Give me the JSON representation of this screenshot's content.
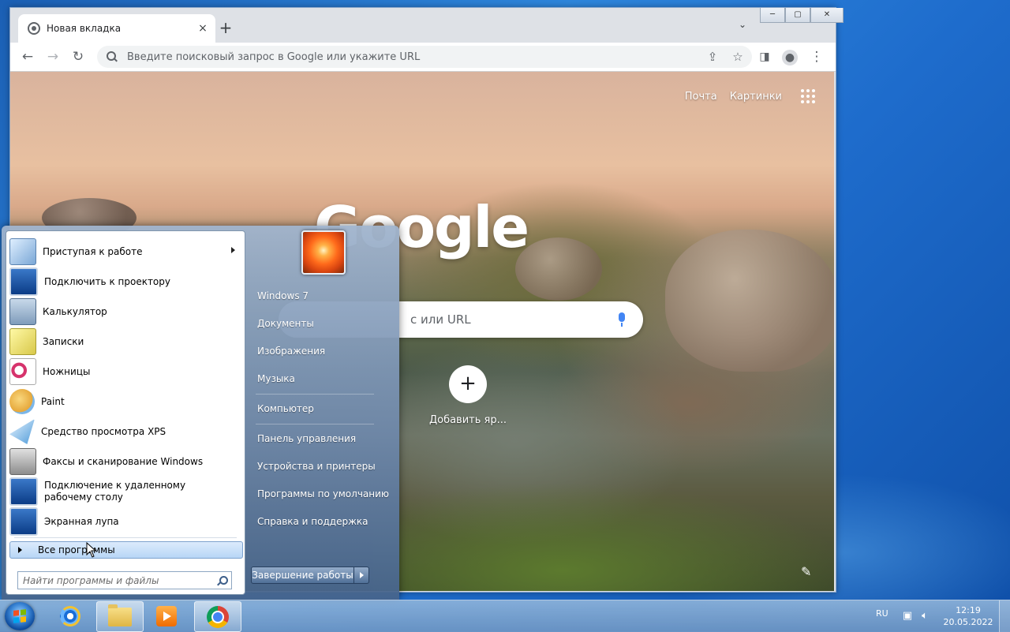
{
  "browser": {
    "tab_title": "Новая вкладка",
    "tab_close": "×",
    "new_tab": "+",
    "tab_search": "⌄",
    "omnibox_placeholder": "Введите поисковый запрос в Google или укажите URL",
    "window_controls": {
      "minimize": "─",
      "maximize": "▢",
      "close": "✕"
    }
  },
  "google_page": {
    "links": [
      "Почта",
      "Картинки"
    ],
    "logo": "Google",
    "search_text": "с или URL",
    "shortcut_add": "+",
    "shortcut_label": "Добавить яр..."
  },
  "start_menu": {
    "programs": [
      {
        "label": "Приступая к работе",
        "icon": "getting-started",
        "has_submenu": true
      },
      {
        "label": "Подключить к проектору",
        "icon": "projector"
      },
      {
        "label": "Калькулятор",
        "icon": "calculator"
      },
      {
        "label": "Записки",
        "icon": "sticky-notes"
      },
      {
        "label": "Ножницы",
        "icon": "snipping-tool"
      },
      {
        "label": "Paint",
        "icon": "paint"
      },
      {
        "label": "Средство просмотра XPS",
        "icon": "xps-viewer"
      },
      {
        "label": "Факсы и сканирование Windows",
        "icon": "fax-scan"
      },
      {
        "label": "Подключение к удаленному рабочему столу",
        "icon": "remote-desktop"
      },
      {
        "label": "Экранная лупа",
        "icon": "magnifier"
      }
    ],
    "all_programs": "Все программы",
    "search_placeholder": "Найти программы и файлы",
    "right_items": [
      "Windows 7",
      "Документы",
      "Изображения",
      "Музыка",
      "Компьютер",
      "Панель управления",
      "Устройства и принтеры",
      "Программы по умолчанию",
      "Справка и поддержка"
    ],
    "shutdown_label": "Завершение работы"
  },
  "taskbar": {
    "apps": [
      "internet-explorer",
      "windows-explorer",
      "media-player",
      "google-chrome"
    ],
    "language": "RU",
    "time": "12:19",
    "date": "20.05.2022"
  }
}
